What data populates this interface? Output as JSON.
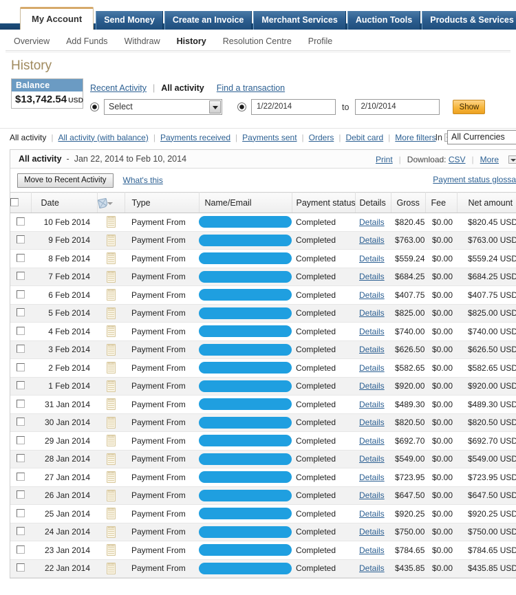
{
  "tabs": [
    {
      "label": "My Account",
      "active": true
    },
    {
      "label": "Send Money",
      "active": false
    },
    {
      "label": "Create an Invoice",
      "active": false
    },
    {
      "label": "Merchant Services",
      "active": false
    },
    {
      "label": "Auction Tools",
      "active": false
    },
    {
      "label": "Products & Services",
      "active": false
    }
  ],
  "subnav": [
    {
      "label": "Overview",
      "active": false
    },
    {
      "label": "Add Funds",
      "active": false
    },
    {
      "label": "Withdraw",
      "active": false
    },
    {
      "label": "History",
      "active": true
    },
    {
      "label": "Resolution Centre",
      "active": false
    },
    {
      "label": "Profile",
      "active": false
    }
  ],
  "page": {
    "title": "History"
  },
  "balance": {
    "label": "Balance",
    "amount": "$13,742.54",
    "currency": "USD"
  },
  "viewlinks": {
    "recent": "Recent Activity",
    "all": "All activity",
    "find": "Find a transaction",
    "separator": "|"
  },
  "daterange": {
    "select_value": "Select",
    "from": "1/22/2014",
    "to_label": "to",
    "to": "2/10/2014",
    "show_button": "Show"
  },
  "filters": {
    "items": [
      {
        "label": "All activity",
        "current": true
      },
      {
        "label": "All activity (with balance)",
        "current": false
      },
      {
        "label": "Payments received",
        "current": false
      },
      {
        "label": "Payments sent",
        "current": false
      },
      {
        "label": "Orders",
        "current": false
      },
      {
        "label": "Debit card",
        "current": false
      },
      {
        "label": "More filters",
        "current": false
      }
    ],
    "separator": "|",
    "in_label": "In",
    "currency_value": "All Currencies"
  },
  "panel": {
    "title": "All activity",
    "dash": "-",
    "range": "Jan 22, 2014 to Feb 10, 2014",
    "print": "Print",
    "download_label": "Download:",
    "csv": "CSV",
    "more": "More",
    "move_button": "Move to Recent Activity",
    "whats_this": "What's this",
    "glossary": "Payment status glossary"
  },
  "table": {
    "columns": {
      "checkbox": "",
      "date": "Date",
      "sort": "",
      "type": "Type",
      "name": "Name/Email",
      "status": "Payment status",
      "details": "Details",
      "gross": "Gross",
      "fee": "Fee",
      "net": "Net amount"
    },
    "details_link": "Details",
    "rows": [
      {
        "date": "10 Feb 2014",
        "type": "Payment From",
        "name": "",
        "status": "Completed",
        "gross": "$820.45",
        "fee": "$0.00",
        "net": "$820.45 USD"
      },
      {
        "date": "9 Feb 2014",
        "type": "Payment From",
        "name": "",
        "status": "Completed",
        "gross": "$763.00",
        "fee": "$0.00",
        "net": "$763.00 USD"
      },
      {
        "date": "8 Feb 2014",
        "type": "Payment From",
        "name": "",
        "status": "Completed",
        "gross": "$559.24",
        "fee": "$0.00",
        "net": "$559.24 USD"
      },
      {
        "date": "7 Feb 2014",
        "type": "Payment From",
        "name": "",
        "status": "Completed",
        "gross": "$684.25",
        "fee": "$0.00",
        "net": "$684.25 USD"
      },
      {
        "date": "6 Feb 2014",
        "type": "Payment From",
        "name": "",
        "status": "Completed",
        "gross": "$407.75",
        "fee": "$0.00",
        "net": "$407.75 USD"
      },
      {
        "date": "5 Feb 2014",
        "type": "Payment From",
        "name": "",
        "status": "Completed",
        "gross": "$825.00",
        "fee": "$0.00",
        "net": "$825.00 USD"
      },
      {
        "date": "4 Feb 2014",
        "type": "Payment From",
        "name": "",
        "status": "Completed",
        "gross": "$740.00",
        "fee": "$0.00",
        "net": "$740.00 USD"
      },
      {
        "date": "3 Feb 2014",
        "type": "Payment From",
        "name": "",
        "status": "Completed",
        "gross": "$626.50",
        "fee": "$0.00",
        "net": "$626.50 USD"
      },
      {
        "date": "2 Feb 2014",
        "type": "Payment From",
        "name": "",
        "status": "Completed",
        "gross": "$582.65",
        "fee": "$0.00",
        "net": "$582.65 USD"
      },
      {
        "date": "1 Feb 2014",
        "type": "Payment From",
        "name": "",
        "status": "Completed",
        "gross": "$920.00",
        "fee": "$0.00",
        "net": "$920.00 USD"
      },
      {
        "date": "31 Jan 2014",
        "type": "Payment From",
        "name": "",
        "status": "Completed",
        "gross": "$489.30",
        "fee": "$0.00",
        "net": "$489.30 USD"
      },
      {
        "date": "30 Jan 2014",
        "type": "Payment From",
        "name": "",
        "status": "Completed",
        "gross": "$820.50",
        "fee": "$0.00",
        "net": "$820.50 USD"
      },
      {
        "date": "29 Jan 2014",
        "type": "Payment From",
        "name": "",
        "status": "Completed",
        "gross": "$692.70",
        "fee": "$0.00",
        "net": "$692.70 USD"
      },
      {
        "date": "28 Jan 2014",
        "type": "Payment From",
        "name": "",
        "status": "Completed",
        "gross": "$549.00",
        "fee": "$0.00",
        "net": "$549.00 USD"
      },
      {
        "date": "27 Jan 2014",
        "type": "Payment From",
        "name": "",
        "status": "Completed",
        "gross": "$723.95",
        "fee": "$0.00",
        "net": "$723.95 USD"
      },
      {
        "date": "26 Jan 2014",
        "type": "Payment From",
        "name": "",
        "status": "Completed",
        "gross": "$647.50",
        "fee": "$0.00",
        "net": "$647.50 USD"
      },
      {
        "date": "25 Jan 2014",
        "type": "Payment From",
        "name": "",
        "status": "Completed",
        "gross": "$920.25",
        "fee": "$0.00",
        "net": "$920.25 USD"
      },
      {
        "date": "24 Jan 2014",
        "type": "Payment From",
        "name": "",
        "status": "Completed",
        "gross": "$750.00",
        "fee": "$0.00",
        "net": "$750.00 USD"
      },
      {
        "date": "23 Jan 2014",
        "type": "Payment From",
        "name": "",
        "status": "Completed",
        "gross": "$784.65",
        "fee": "$0.00",
        "net": "$784.65 USD"
      },
      {
        "date": "22 Jan 2014",
        "type": "Payment From",
        "name": "",
        "status": "Completed",
        "gross": "$435.85",
        "fee": "$0.00",
        "net": "$435.85 USD"
      }
    ]
  }
}
